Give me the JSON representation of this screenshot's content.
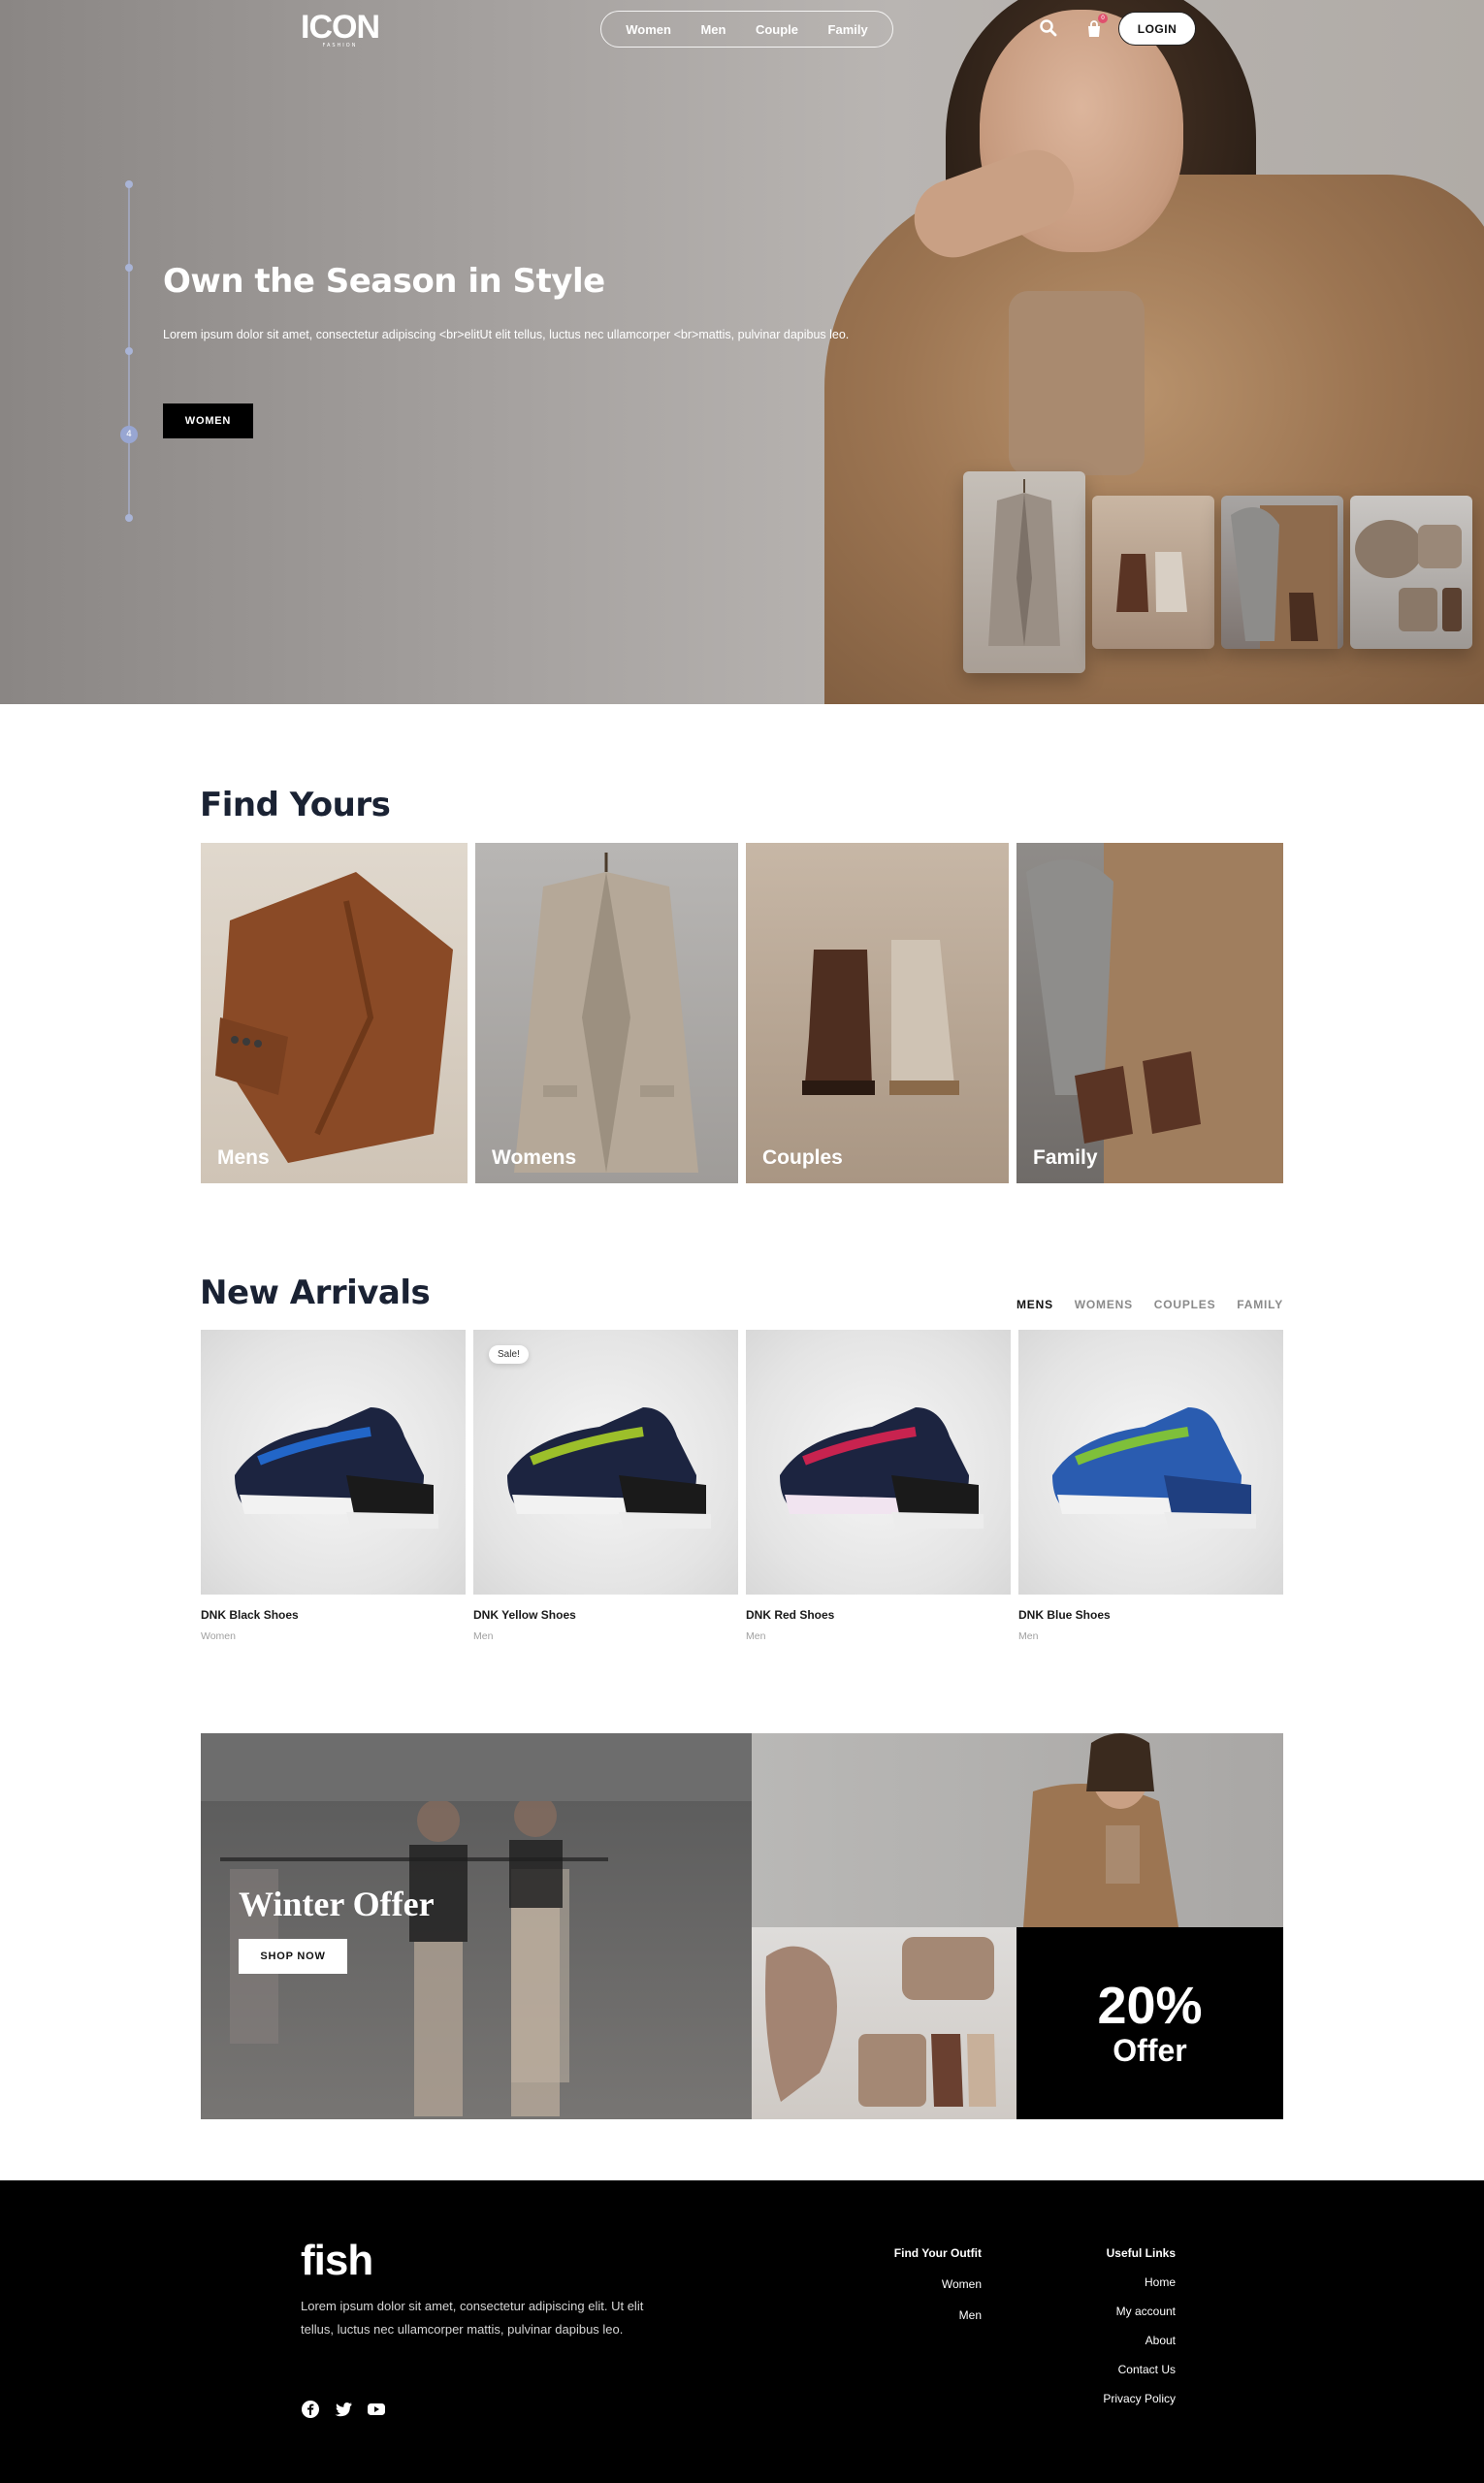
{
  "header": {
    "logo_text": "ICON",
    "logo_sub": "FASHION",
    "nav": [
      "Women",
      "Men",
      "Couple",
      "Family"
    ],
    "cart_count": "0",
    "login_label": "LOGIN"
  },
  "hero": {
    "title": "Own the Season in Style",
    "description": "Lorem ipsum dolor sit amet, consectetur adipiscing <br>elitUt elit tellus, luctus nec ullamcorper <br>mattis, pulvinar dapibus leo.",
    "cta_label": "WOMEN",
    "active_slide": "4"
  },
  "find_yours": {
    "title": "Find Yours",
    "categories": [
      "Mens",
      "Womens",
      "Couples",
      "Family"
    ]
  },
  "new_arrivals": {
    "title": "New Arrivals",
    "tabs": [
      "MENS",
      "WOMENS",
      "COUPLES",
      "FAMILY"
    ],
    "active_tab": "MENS",
    "sale_label": "Sale!",
    "products": [
      {
        "name": "DNK Black Shoes",
        "category": "Women",
        "accent": "#2266c8"
      },
      {
        "name": "DNK Yellow Shoes",
        "category": "Men",
        "accent": "#9cbf2a"
      },
      {
        "name": "DNK Red Shoes",
        "category": "Men",
        "accent": "#c8234f"
      },
      {
        "name": "DNK Blue Shoes",
        "category": "Men",
        "accent": "#2a7bd8"
      }
    ]
  },
  "promo": {
    "title": "Winter Offer",
    "button_label": "SHOP NOW",
    "offer_percent": "20%",
    "offer_word": "Offer"
  },
  "footer": {
    "logo_text": "fish",
    "description": "Lorem ipsum dolor sit amet, consectetur adipiscing elit. Ut elit tellus, luctus nec ullamcorper mattis, pulvinar dapibus leo.",
    "socials": [
      "facebook-icon",
      "twitter-icon",
      "youtube-icon"
    ],
    "col_outfit": {
      "title": "Find Your Outfit",
      "links": [
        "Women",
        "Men"
      ]
    },
    "col_useful": {
      "title": "Useful Links",
      "links": [
        "Home",
        "My account",
        "About",
        "Contact Us",
        "Privacy Policy"
      ]
    }
  }
}
